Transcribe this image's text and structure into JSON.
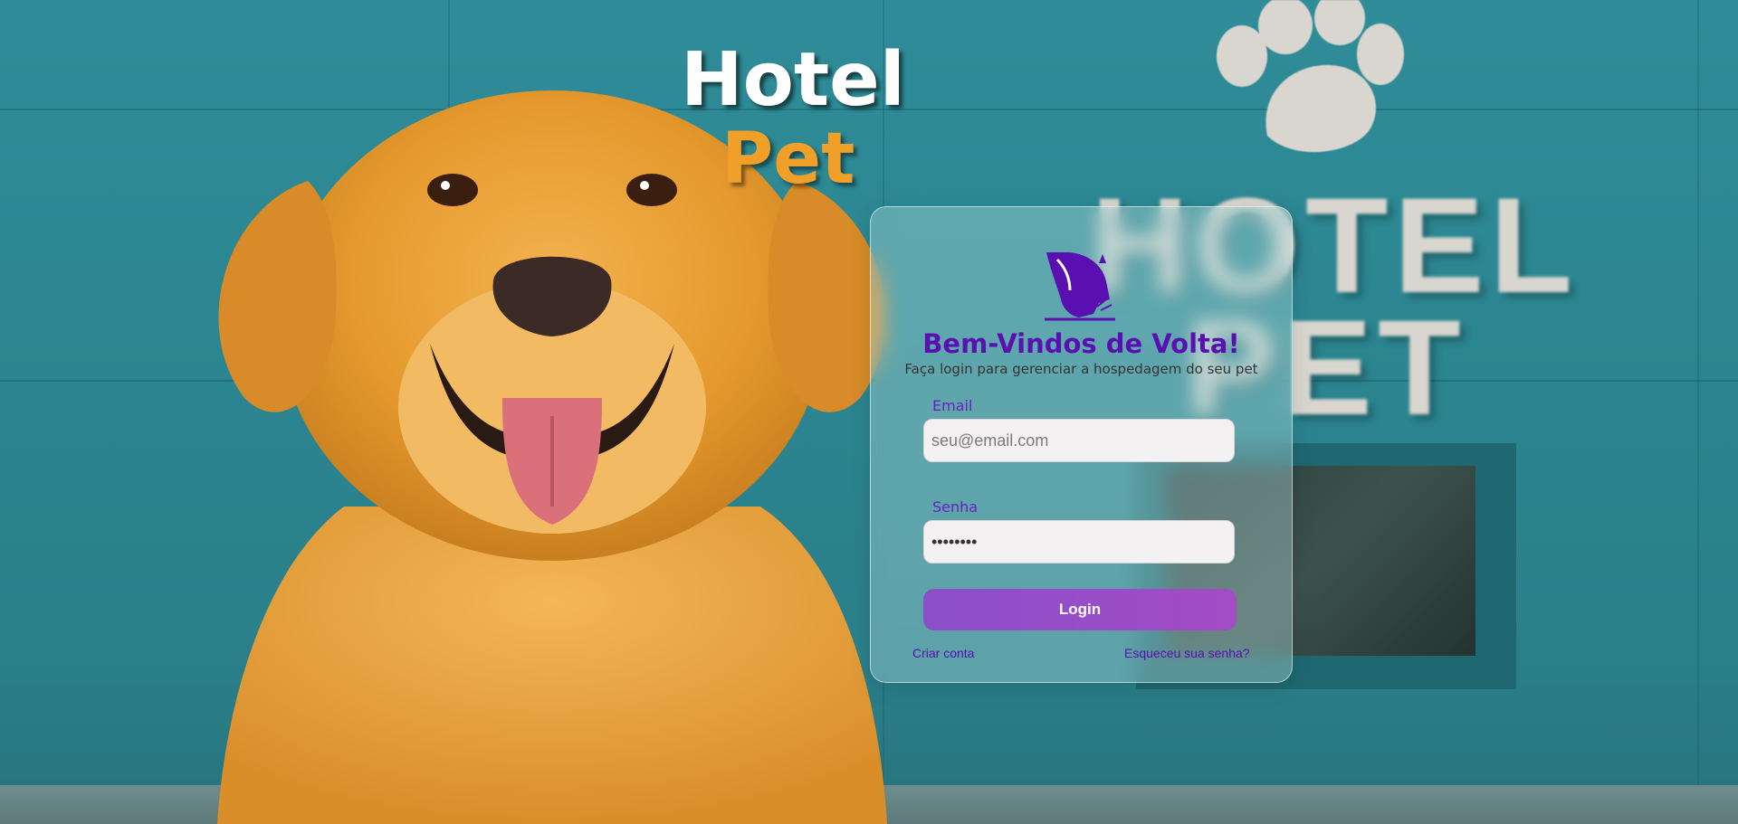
{
  "brand": {
    "title_line1": "Hotel",
    "title_line2": "Pet"
  },
  "background_sign": {
    "line1": "HOTEL",
    "line2": "PET",
    "icon": "paw-icon"
  },
  "login_card": {
    "logo_icon": "dog-head-logo-icon",
    "title": "Bem-Vindos de Volta!",
    "subtitle": "Faça login para gerenciar a hospedagem do seu pet",
    "email_label": "Email",
    "email_placeholder": "seu@email.com",
    "password_label": "Senha",
    "password_value": "••••••••",
    "login_button": "Login",
    "create_account_link": "Criar conta",
    "forgot_password_link": "Esqueceu sua senha?"
  },
  "colors": {
    "background_teal": "#2f8c98",
    "accent_purple": "#5a0fb0",
    "button_gradient_start": "#8b4fc9",
    "button_gradient_end": "#a34cc6",
    "brand_orange": "#f0a028"
  }
}
